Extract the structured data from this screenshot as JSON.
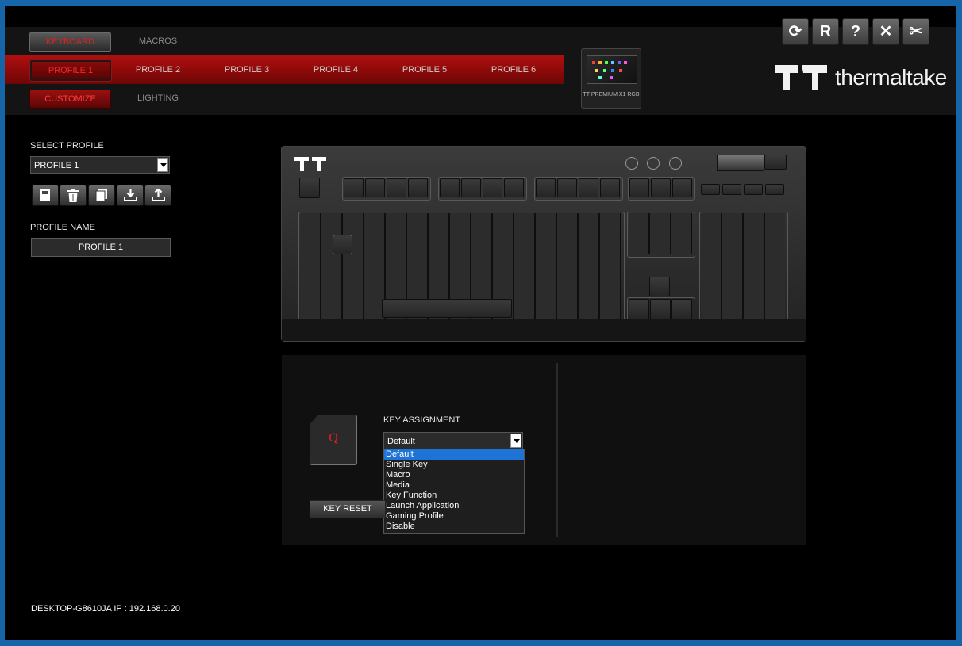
{
  "nav": {
    "row1": [
      "KEYBOARD",
      "MACROS"
    ],
    "profiles": [
      "PROFILE 1",
      "PROFILE 2",
      "PROFILE 3",
      "PROFILE 4",
      "PROFILE 5",
      "PROFILE 6"
    ],
    "row3": [
      "CUSTOMIZE",
      "LIGHTING"
    ]
  },
  "window_buttons": [
    {
      "name": "refresh-icon",
      "glyph": "⟳"
    },
    {
      "name": "reset-r-icon",
      "glyph": "R"
    },
    {
      "name": "help-icon",
      "glyph": "?"
    },
    {
      "name": "close-icon",
      "glyph": "✕"
    },
    {
      "name": "settings-tools-icon",
      "glyph": "✂"
    }
  ],
  "device": {
    "name": "TT PREMIUM X1 RGB"
  },
  "brand": {
    "text": "thermaltake"
  },
  "sidebar": {
    "select_profile_label": "SELECT PROFILE",
    "selected_profile": "PROFILE 1",
    "tool_buttons": [
      "save-icon",
      "delete-icon",
      "copy-icon",
      "import-icon",
      "export-icon"
    ],
    "profile_name_label": "PROFILE NAME",
    "profile_name_value": "PROFILE 1"
  },
  "key_panel": {
    "selected_key": "Q",
    "assignment_label": "KEY ASSIGNMENT",
    "assignment_value": "Default",
    "options": [
      "Default",
      "Single Key",
      "Macro",
      "Media",
      "Key Function",
      "Launch Application",
      "Gaming Profile",
      "Disable"
    ],
    "highlighted": "Default",
    "reset_label": "KEY RESET"
  },
  "footer": {
    "text": "DESKTOP-G8610JA IP : 192.168.0.20"
  },
  "colors": {
    "accent": "#b10f0f",
    "highlight": "#1e73d6",
    "background": "#000000"
  }
}
